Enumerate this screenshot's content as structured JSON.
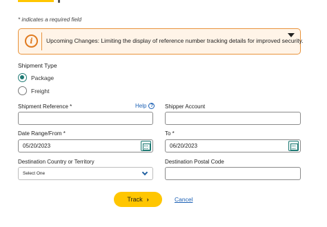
{
  "required_note": "* indicates a required field",
  "alert": {
    "icon": "info-icon",
    "icon_glyph": "i",
    "text": "Upcoming Changes: Limiting the display of reference number tracking details for improved security."
  },
  "shipment_type": {
    "label": "Shipment Type",
    "options": [
      {
        "label": "Package",
        "selected": true
      },
      {
        "label": "Freight",
        "selected": false
      }
    ]
  },
  "fields": {
    "shipment_reference_label": "Shipment Reference *",
    "help_label": "Help",
    "help_glyph": "?",
    "shipper_account_label": "Shipper Account",
    "date_from_label": "Date Range/From *",
    "date_from_value": "05/20/2023",
    "date_to_label": "To *",
    "date_to_value": "06/20/2023",
    "destination_country_label": "Destination Country or Territory",
    "destination_country_value": "Select One",
    "destination_postal_label": "Destination Postal Code"
  },
  "actions": {
    "track_label": "Track",
    "track_arrow": "›",
    "cancel_label": "Cancel"
  },
  "colors": {
    "accent": "#ffc600",
    "alert_border": "#e8923a",
    "radio_selected": "#1f7a74",
    "link": "#1a5fb4"
  }
}
